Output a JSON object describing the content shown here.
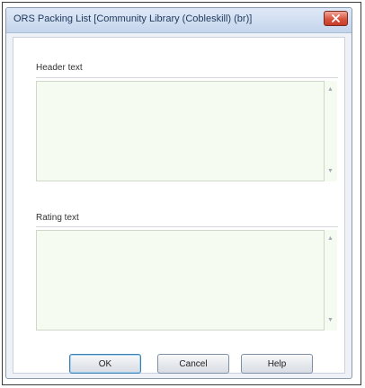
{
  "dialog": {
    "title": "ORS Packing List [Community Library (Cobleskill) (br)]",
    "close_icon": "close-icon"
  },
  "header_section": {
    "label": "Header text",
    "value": ""
  },
  "rating_section": {
    "label": "Rating text",
    "value": ""
  },
  "buttons": {
    "ok": "OK",
    "cancel": "Cancel",
    "help": "Help"
  },
  "colors": {
    "textarea_bg": "#f6fbf2",
    "close_button": "#d8543f",
    "title_text": "#1e395b"
  }
}
